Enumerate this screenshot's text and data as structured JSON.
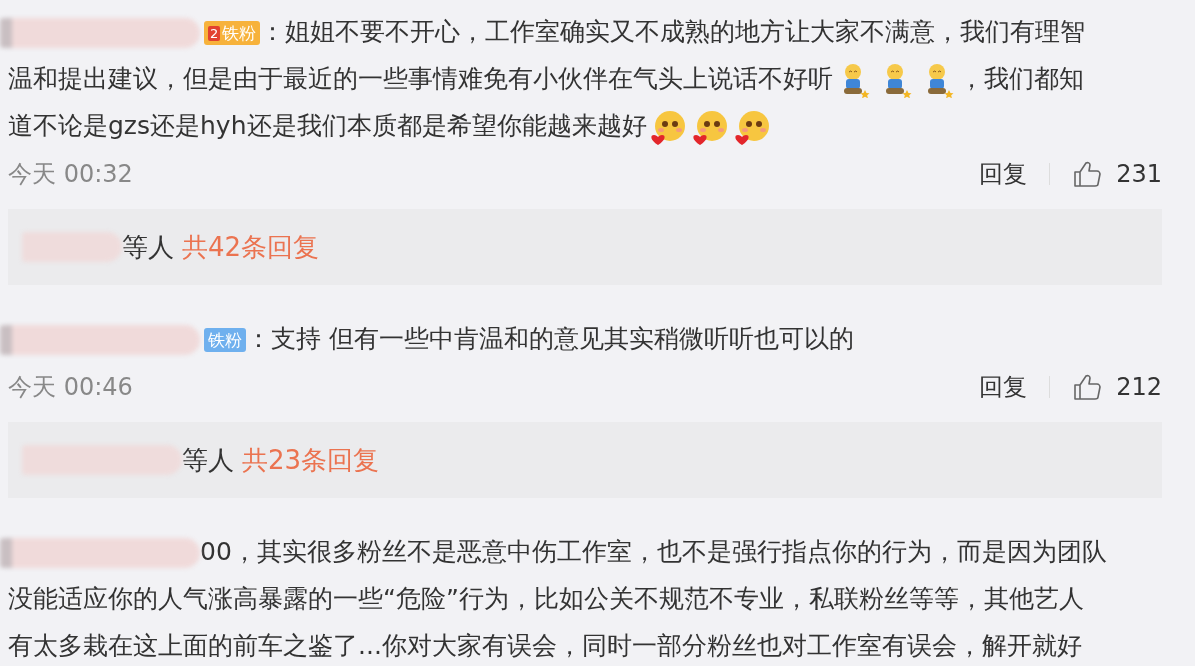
{
  "comments": [
    {
      "badge": {
        "kind": "gold",
        "level": "2",
        "label": "铁粉"
      },
      "segments": [
        {
          "kind": "text",
          "text": "：姐姐不要不开心，工作室确实又不成熟的地方让大家不满意，我们有理智"
        },
        {
          "kind": "break"
        },
        {
          "kind": "text",
          "text": "温和提出建议，但是由于最近的一些事情难免有小伙伴在气头上说话不好听"
        },
        {
          "kind": "kneel_emoji"
        },
        {
          "kind": "kneel_emoji"
        },
        {
          "kind": "kneel_emoji"
        },
        {
          "kind": "text",
          "text": "，我们都知"
        },
        {
          "kind": "break"
        },
        {
          "kind": "text",
          "text": "道不论是gzs还是hyh还是我们本质都是希望你能越来越好"
        },
        {
          "kind": "heart_emoji"
        },
        {
          "kind": "heart_emoji"
        },
        {
          "kind": "heart_emoji"
        }
      ],
      "time": "今天 00:32",
      "reply": "回复",
      "likes": "231",
      "replies": {
        "suffix": "等人",
        "count": "共42条回复"
      }
    },
    {
      "badge": {
        "kind": "blue",
        "label": "铁粉"
      },
      "segments": [
        {
          "kind": "text",
          "text": "：支持 但有一些中肯温和的意见其实稍微听听也可以的"
        }
      ],
      "time": "今天 00:46",
      "reply": "回复",
      "likes": "212",
      "replies": {
        "suffix": "等人",
        "count": "共23条回复"
      }
    },
    {
      "segments": [
        {
          "kind": "text",
          "text": "00，其实很多粉丝不是恶意中伤工作室，也不是强行指点你的行为，而是因为团队"
        },
        {
          "kind": "break"
        },
        {
          "kind": "text",
          "text": "没能适应你的人气涨高暴露的一些“危险”行为，比如公关不规范不专业，私联粉丝等等，其他艺人"
        },
        {
          "kind": "break"
        },
        {
          "kind": "text",
          "text": "有太多栽在这上面的前车之鉴了...你对大家有误会，同时一部分粉丝也对工作室有误会，解开就好"
        }
      ]
    }
  ]
}
